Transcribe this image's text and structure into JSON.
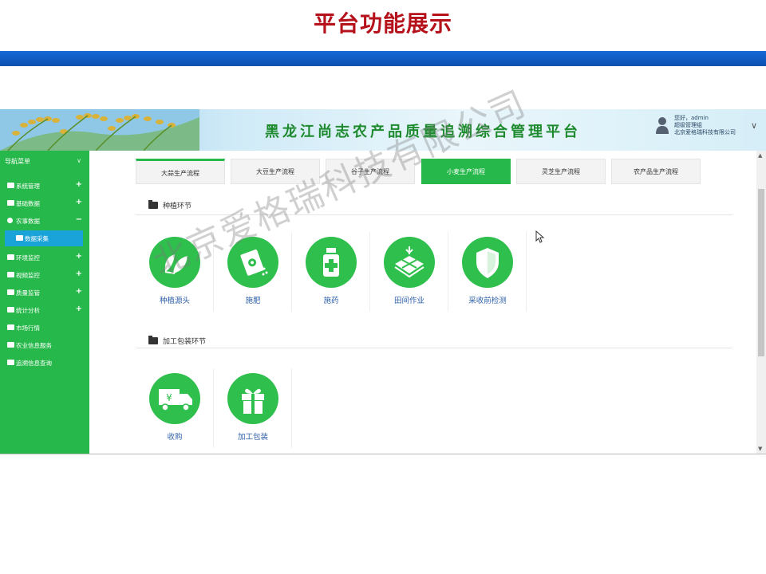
{
  "slide": {
    "title": "平台功能展示"
  },
  "app": {
    "title": "黑龙江尚志农产品质量追溯综合管理平台",
    "user": {
      "greeting": "您好，admin",
      "role": "超级管理组",
      "company": "北京爱格瑞科技有限公司"
    }
  },
  "sidebar": {
    "header": "导航菜单",
    "items": [
      {
        "label": "系统管理",
        "toggle": "+"
      },
      {
        "label": "基础数据",
        "toggle": "+"
      },
      {
        "label": "农事数据",
        "toggle": "−"
      },
      {
        "label": "数据采集",
        "toggle": ""
      },
      {
        "label": "环境监控",
        "toggle": "+"
      },
      {
        "label": "视频监控",
        "toggle": "+"
      },
      {
        "label": "质量监管",
        "toggle": "+"
      },
      {
        "label": "统计分析",
        "toggle": "+"
      },
      {
        "label": "市场行情",
        "toggle": ""
      },
      {
        "label": "农业信息服务",
        "toggle": ""
      },
      {
        "label": "追溯信息查询",
        "toggle": ""
      }
    ]
  },
  "tabs": [
    {
      "label": "大蒜生产流程"
    },
    {
      "label": "大豆生产流程"
    },
    {
      "label": "谷子生产流程"
    },
    {
      "label": "小麦生产流程"
    },
    {
      "label": "灵芝生产流程"
    },
    {
      "label": "农产品生产流程"
    }
  ],
  "sections": {
    "planting": {
      "title": "种植环节",
      "items": [
        {
          "label": "种植源头",
          "icon": "leaf-icon"
        },
        {
          "label": "施肥",
          "icon": "fertilizer-bag-icon"
        },
        {
          "label": "施药",
          "icon": "medicine-bottle-icon"
        },
        {
          "label": "田间作业",
          "icon": "field-icon"
        },
        {
          "label": "采收前检测",
          "icon": "shield-icon"
        }
      ]
    },
    "processing": {
      "title": "加工包装环节",
      "items": [
        {
          "label": "收购",
          "icon": "purchase-truck-icon"
        },
        {
          "label": "加工包装",
          "icon": "gift-box-icon"
        }
      ]
    }
  },
  "watermark": "北京爱格瑞科技有限公司",
  "colors": {
    "brand_green": "#26b84a",
    "icon_green": "#2fbf4d",
    "active_blue": "#1aa3d9",
    "title_red": "#b5121b",
    "bar_blue": "#0b5fc9"
  }
}
